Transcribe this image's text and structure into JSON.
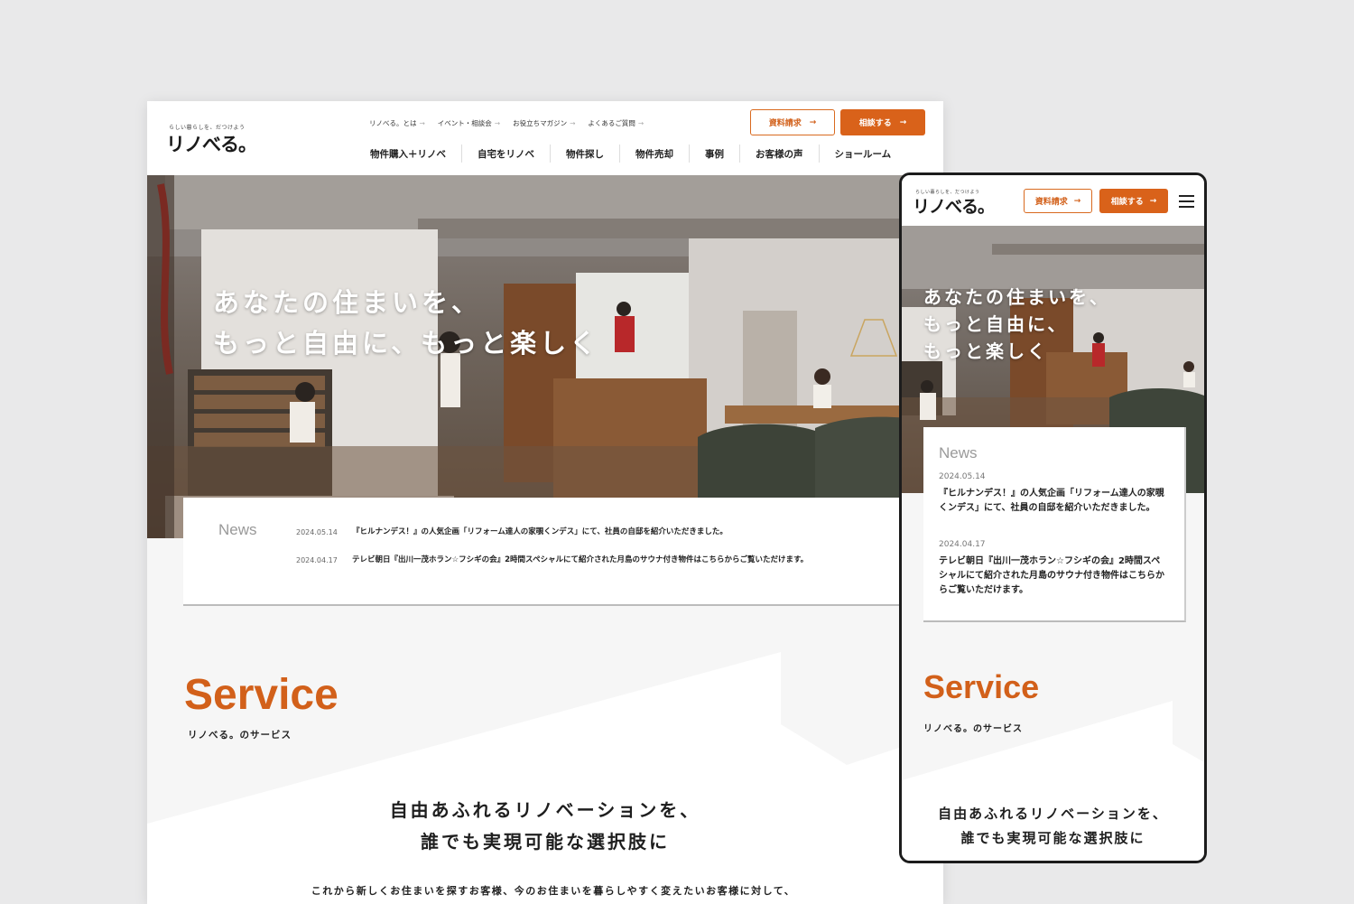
{
  "desktop": {
    "logo": {
      "tagline": "らしい暮らしを、だつけよう",
      "name": "リノべる。"
    },
    "sub_nav": [
      {
        "label": "リノべる。とは"
      },
      {
        "label": "イベント・相談会"
      },
      {
        "label": "お役立ちマガジン"
      },
      {
        "label": "よくあるご質問"
      }
    ],
    "buttons": {
      "request": "資料請求",
      "consult": "相談する",
      "arrow": "→"
    },
    "main_nav": [
      "物件購入＋リノベ",
      "自宅をリノベ",
      "物件探し",
      "物件売却",
      "事例",
      "お客様の声",
      "ショールーム"
    ],
    "hero": {
      "line1": "あなたの住まいを、",
      "line2": "もっと自由に、もっと楽しく"
    },
    "news": {
      "heading": "News",
      "items": [
        {
          "date": "2024.05.14",
          "text": "『ヒルナンデス！』の人気企画「リフォーム達人の家覗くンデス」にて、社員の自邸を紹介いただきました。"
        },
        {
          "date": "2024.04.17",
          "text": "テレビ朝日『出川一茂ホラン☆フシギの会』2時間スペシャルにて紹介された月島のサウナ付き物件はこちらからご覧いただけます。"
        }
      ]
    },
    "service": {
      "title": "Service",
      "subtitle": "リノべる。のサービス",
      "lead_line1": "自由あふれるリノベーションを、",
      "lead_line2": "誰でも実現可能な選択肢に",
      "body": "これから新しくお住まいを探すお客様、今のお住まいを暮らしやすく変えたいお客様に対して、"
    }
  },
  "mobile": {
    "logo": {
      "tagline": "らしい暮らしを、だつけよう",
      "name": "リノべる。"
    },
    "buttons": {
      "request": "資料請求",
      "consult": "相談する",
      "arrow": "→"
    },
    "hero": {
      "line1": "あなたの住まいを、",
      "line2": "もっと自由に、",
      "line3": "もっと楽しく"
    },
    "news": {
      "heading": "News",
      "items": [
        {
          "date": "2024.05.14",
          "text": "『ヒルナンデス！』の人気企画「リフォーム達人の家覗くンデス」にて、社員の自邸を紹介いただきました。"
        },
        {
          "date": "2024.04.17",
          "text": "テレビ朝日『出川一茂ホラン☆フシギの会』2時間スペシャルにて紹介された月島のサウナ付き物件はこちらからご覧いただけます。"
        }
      ]
    },
    "service": {
      "title": "Service",
      "subtitle": "リノべる。のサービス",
      "lead_line1": "自由あふれるリノベーションを、",
      "lead_line2": "誰でも実現可能な選択肢に"
    }
  },
  "colors": {
    "accent": "#d9621a",
    "background": "#e9e9ea",
    "panel": "#f6f6f6"
  }
}
